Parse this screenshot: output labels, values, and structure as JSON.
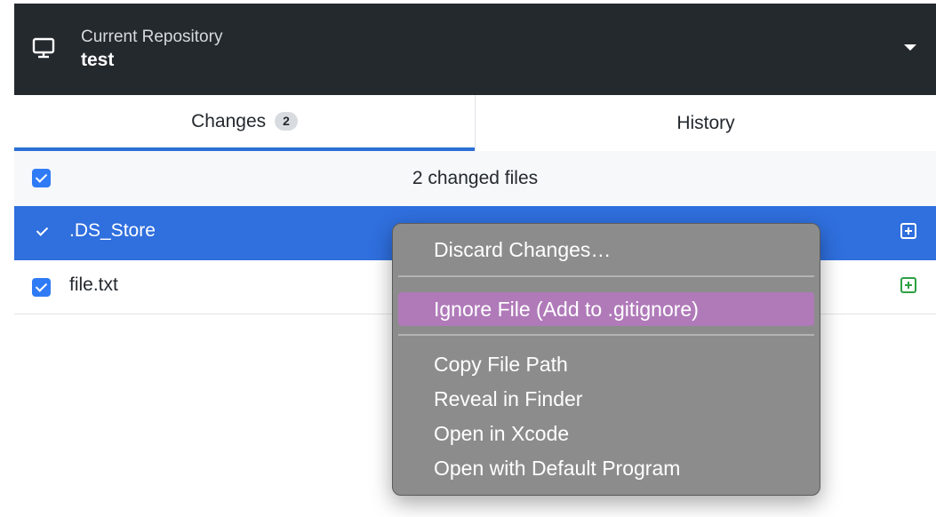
{
  "repository": {
    "caption": "Current Repository",
    "name": "test",
    "icon": "desktop-icon"
  },
  "tabs": [
    {
      "label": "Changes",
      "count": "2",
      "active": true
    },
    {
      "label": "History",
      "active": false
    }
  ],
  "changes_header": {
    "label": "2 changed files",
    "checked": true
  },
  "files": [
    {
      "name": ".DS_Store",
      "checked": true,
      "selected": true,
      "status": "added",
      "status_icon": "plus-square-icon"
    },
    {
      "name": "file.txt",
      "checked": true,
      "selected": false,
      "status": "added",
      "status_icon": "plus-square-icon"
    }
  ],
  "context_menu": {
    "items": [
      {
        "label": "Discard Changes…",
        "highlighted": false
      },
      {
        "label": "Ignore File (Add to .gitignore)",
        "highlighted": true
      },
      {
        "label": "Copy File Path",
        "highlighted": false
      },
      {
        "label": "Reveal in Finder",
        "highlighted": false
      },
      {
        "label": "Open in Xcode",
        "highlighted": false
      },
      {
        "label": "Open with Default Program",
        "highlighted": false
      }
    ]
  },
  "colors": {
    "toolbar_bg": "#24292e",
    "selected_row": "#2f6fde",
    "active_tab_underline": "#2a6fd6",
    "added_green": "#2ea043",
    "menu_highlight": "#b07ab9"
  }
}
